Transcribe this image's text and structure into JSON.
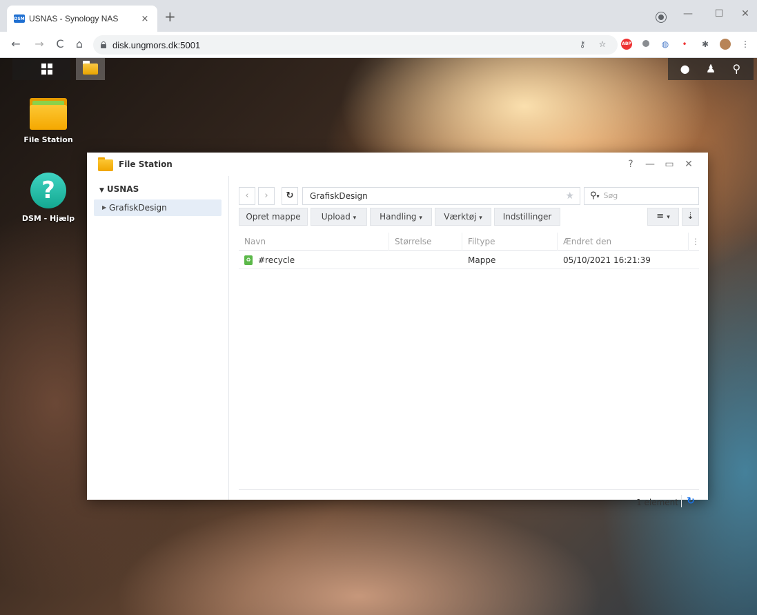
{
  "browser": {
    "tab_title": "USNAS - Synology NAS",
    "tab_favicon": "DSM",
    "tab_close": "×",
    "new_tab": "+",
    "url": "disk.ungmors.dk:5001",
    "window_controls": {
      "minimize": "—",
      "maximize": "☐",
      "close": "✕"
    },
    "nav": {
      "back": "←",
      "forward": "→",
      "reload": "C",
      "home": "⌂"
    },
    "extensions": [
      "key-icon",
      "star-icon",
      "abp-icon",
      "circle-icon",
      "opera-icon",
      "record-icon",
      "puzzle-icon",
      "avatar-icon",
      "menu-icon"
    ]
  },
  "desktop": {
    "icons": [
      {
        "label": "File Station",
        "icon": "folder-icon"
      },
      {
        "label": "DSM - Hjælp",
        "icon": "help-icon",
        "glyph": "?"
      }
    ],
    "tray": [
      "chat-icon",
      "user-icon",
      "search-icon"
    ]
  },
  "window": {
    "title": "File Station",
    "controls": {
      "help": "?",
      "minimize": "—",
      "maximize": "▭",
      "close": "✕"
    },
    "sidebar": {
      "root": "USNAS",
      "items": [
        {
          "label": "GrafiskDesign"
        }
      ]
    },
    "path": "GrafiskDesign",
    "search_placeholder": "Søg",
    "actions": [
      "Opret mappe",
      "Upload",
      "Handling",
      "Værktøj",
      "Indstillinger"
    ],
    "dropdown_caret": "▾",
    "columns": [
      "Navn",
      "Størrelse",
      "Filtype",
      "Ændret den"
    ],
    "rows": [
      {
        "name": "#recycle",
        "size": "",
        "type": "Mappe",
        "modified": "05/10/2021 16:21:39"
      }
    ],
    "status": "1 element",
    "colors": {
      "accent": "#1a73e8",
      "selected": "#e5edf7",
      "folder": "#f5a800",
      "help": "#14a891"
    }
  }
}
